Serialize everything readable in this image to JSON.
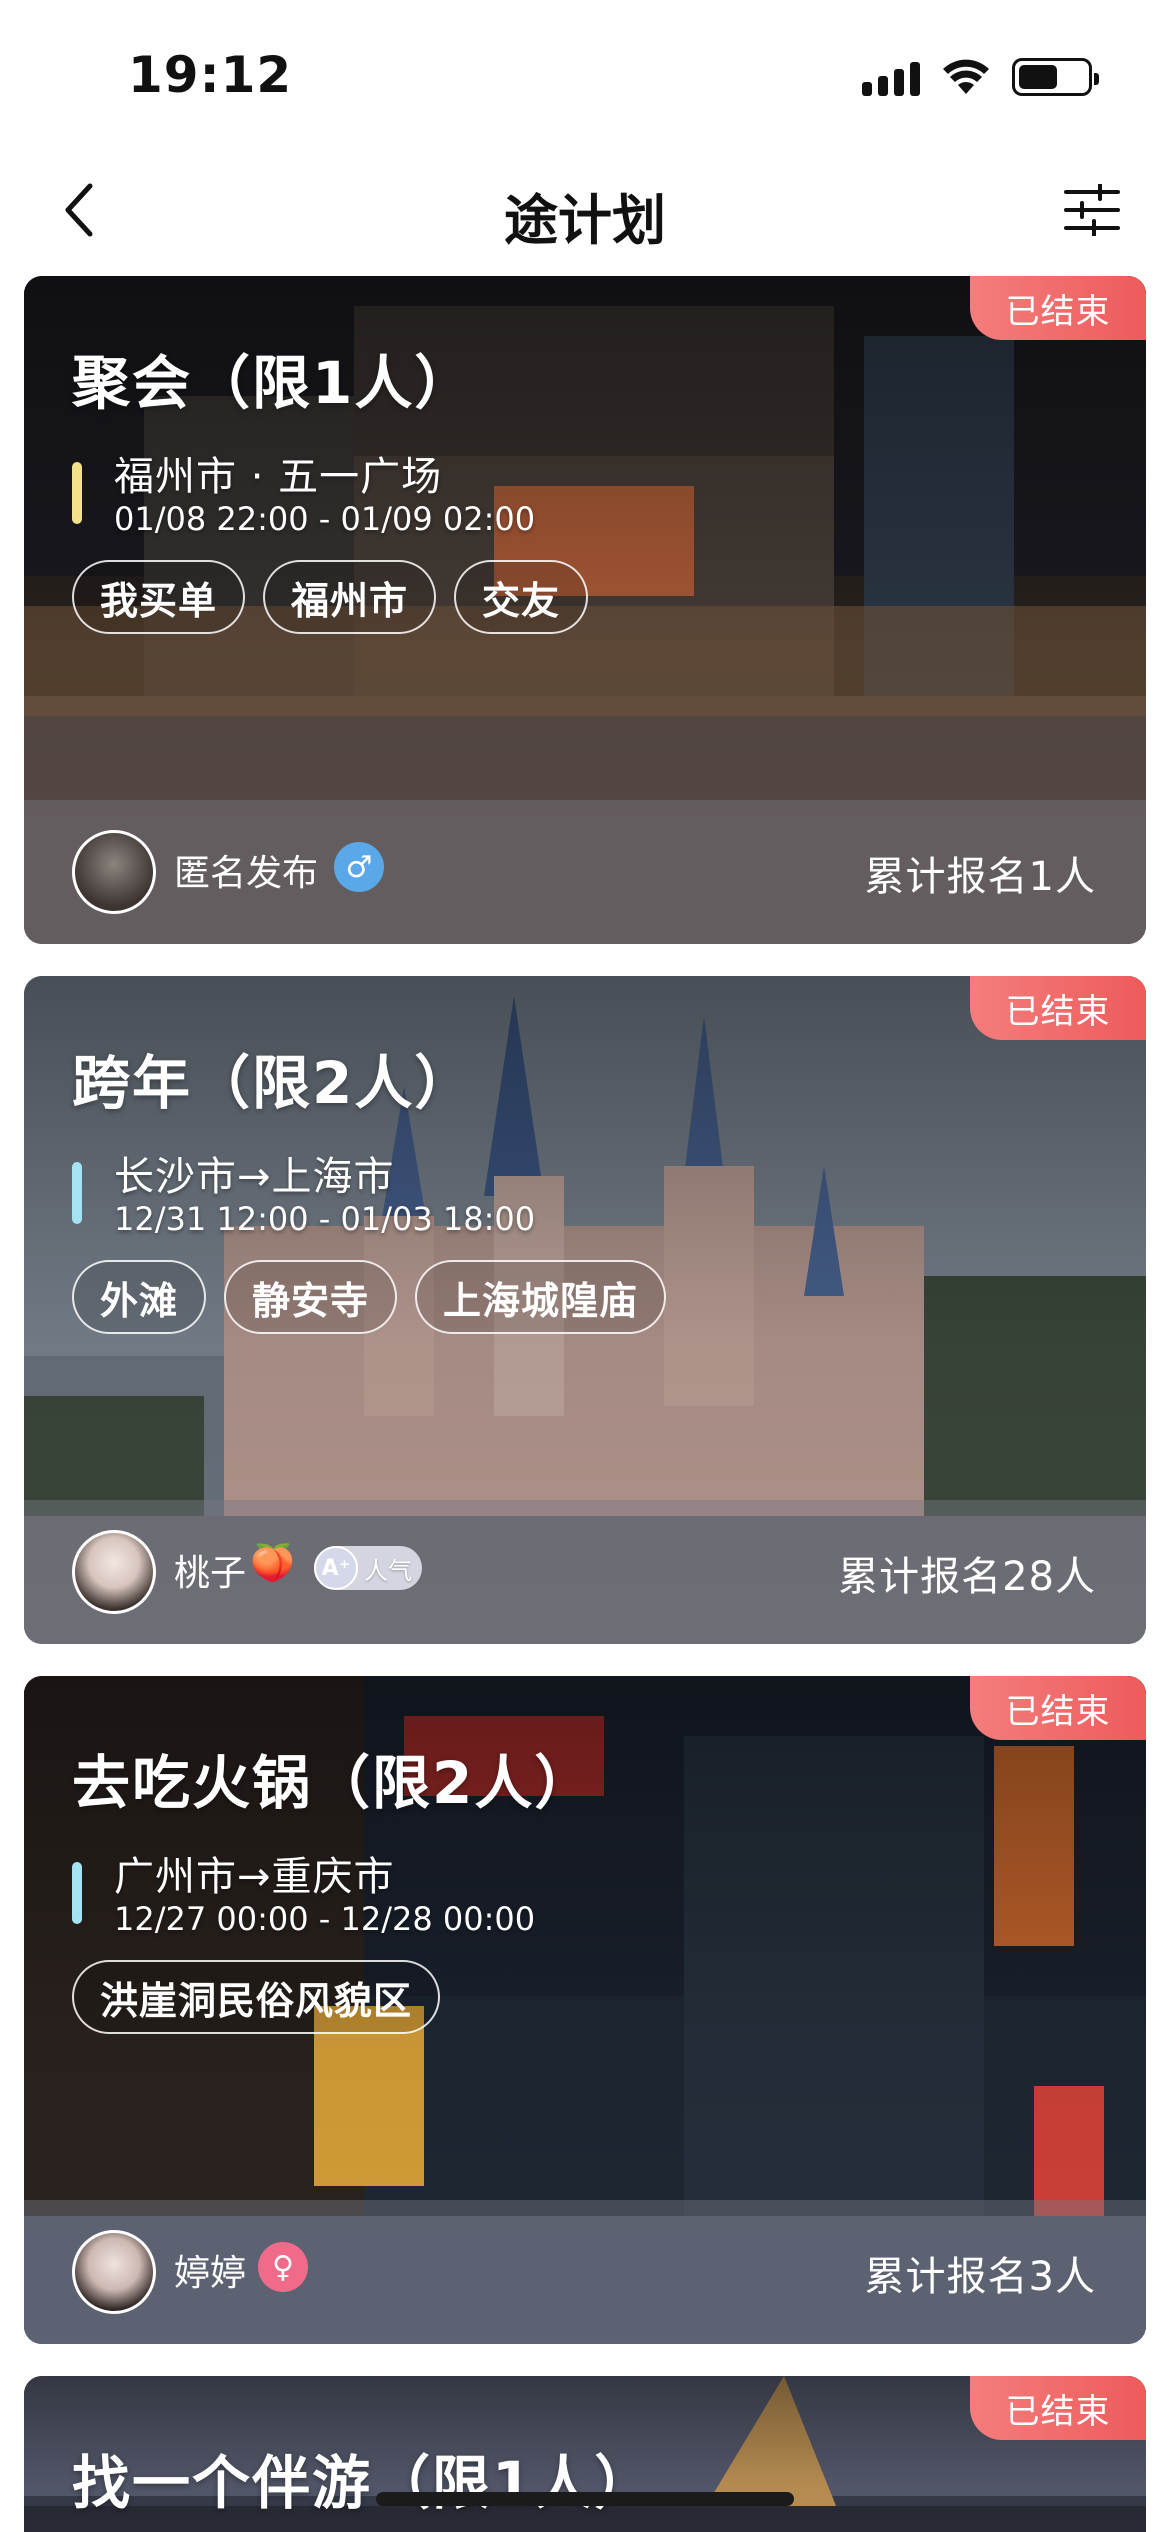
{
  "status_bar": {
    "time": "19:12"
  },
  "nav": {
    "title": "途计划"
  },
  "colors": {
    "badge": "#ee5b5b",
    "accent_yellow": "#f4e28a",
    "accent_cyan": "#a6e3f2",
    "accent_pink": "#f06b8a",
    "accent_blue": "#5aa8e8"
  },
  "cards": [
    {
      "status": "已结束",
      "title": "聚会（限1人）",
      "route": "福州市 · 五一广场",
      "dates": "01/08 22:00 - 01/09 02:00",
      "tags": [
        "我买单",
        "福州市",
        "交友"
      ],
      "user": {
        "name": "匿名发布",
        "gender_icon": "male-icon"
      },
      "count": "累计报名1人"
    },
    {
      "status": "已结束",
      "title": "跨年（限2人）",
      "route": "长沙市→上海市",
      "dates": "12/31 12:00 - 01/03 18:00",
      "tags": [
        "外滩",
        "静安寺",
        "上海城隍庙"
      ],
      "user": {
        "name": "桃子",
        "emoji": "🍑",
        "level_badge": "A⁺",
        "level_text": "人气"
      },
      "count": "累计报名28人"
    },
    {
      "status": "已结束",
      "title": "去吃火锅（限2人）",
      "route": "广州市→重庆市",
      "dates": "12/27 00:00 - 12/28 00:00",
      "tags": [
        "洪崖洞民俗风貌区"
      ],
      "user": {
        "name": "婷婷",
        "gender_icon": "female-icon"
      },
      "count": "累计报名3人"
    },
    {
      "status": "已结束",
      "title": "找一个伴游（限1人）"
    }
  ]
}
